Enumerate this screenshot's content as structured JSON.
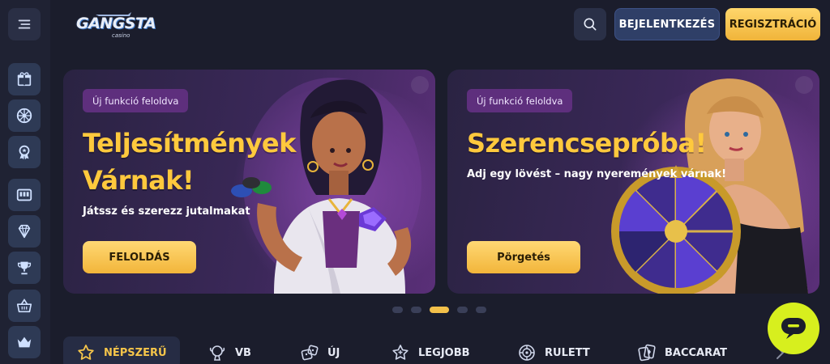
{
  "header": {
    "logo_text": "GANGSTA",
    "logo_sub": "casino",
    "login_label": "BEJELENTKEZÉS",
    "register_label": "REGISZTRÁCIÓ"
  },
  "sidebar": {
    "items": [
      {
        "name": "gift-icon"
      },
      {
        "name": "wheel-icon"
      },
      {
        "name": "medal-icon"
      },
      {
        "name": "slot-machine-icon"
      },
      {
        "name": "diamond-icon"
      },
      {
        "name": "trophy-icon"
      },
      {
        "name": "basket-icon"
      },
      {
        "name": "crown-icon"
      }
    ]
  },
  "banners": [
    {
      "badge": "Új funkció feloldva",
      "title_line1": "Teljesítmények",
      "title_line2": "Várnak!",
      "subtitle": "Játssz és szerezz jutalmakat",
      "button": "FELOLDÁS"
    },
    {
      "badge": "Új funkció feloldva",
      "title_line1": "Szerencsepróba!",
      "subtitle": "Adj egy lövést – nagy nyeremények várnak!",
      "button": "Pörgetés"
    }
  ],
  "carousel": {
    "count": 5,
    "active_index": 2
  },
  "tabs": [
    {
      "label": "NÉPSZERŰ",
      "icon": "star-icon",
      "active": true
    },
    {
      "label": "VB",
      "icon": "world-cup-icon",
      "active": false
    },
    {
      "label": "ÚJ",
      "icon": "dice-icon",
      "active": false
    },
    {
      "label": "LEGJOBB",
      "icon": "sparkle-star-icon",
      "active": false
    },
    {
      "label": "RULETT",
      "icon": "roulette-icon",
      "active": false
    },
    {
      "label": "BACCARAT",
      "icon": "cards-icon",
      "active": false
    }
  ],
  "colors": {
    "accent_gold": "#f5c54a",
    "login_blue": "#2f3f67",
    "chat_lime": "#d7ef1e",
    "background": "#1b1d2c"
  }
}
